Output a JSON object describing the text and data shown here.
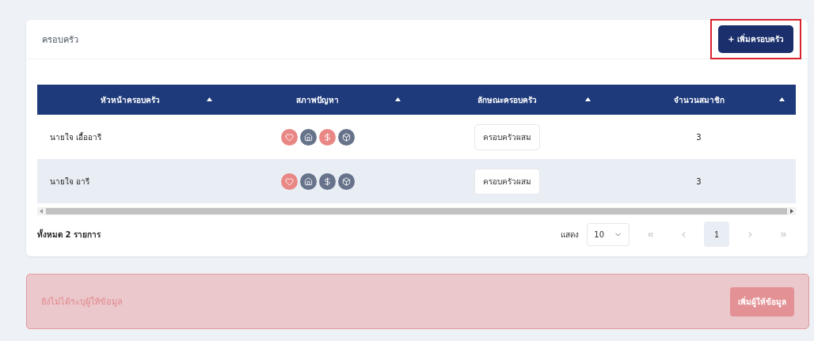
{
  "card": {
    "title": "ครอบครัว",
    "add_button": {
      "label": "+ เพิ่มครอบครัว",
      "highlighted": true
    }
  },
  "table": {
    "columns": [
      {
        "label": "หัวหน้าครอบครัว"
      },
      {
        "label": "สภาพปัญหา"
      },
      {
        "label": "ลักษณะครอบครัว"
      },
      {
        "label": "จำนวนสมาชิก"
      }
    ],
    "rows": [
      {
        "head": "นายใจ เอื้ออารี",
        "problems": [
          {
            "kind": "health",
            "active": true
          },
          {
            "kind": "housing",
            "active": false
          },
          {
            "kind": "income",
            "active": true
          },
          {
            "kind": "goods",
            "active": false
          }
        ],
        "family_type": "ครอบครัวผสม",
        "members": "3"
      },
      {
        "head": "นายใจ อารี",
        "problems": [
          {
            "kind": "health",
            "active": true
          },
          {
            "kind": "housing",
            "active": false
          },
          {
            "kind": "income",
            "active": false
          },
          {
            "kind": "goods",
            "active": false
          }
        ],
        "family_type": "ครอบครัวผสม",
        "members": "3"
      }
    ]
  },
  "footer": {
    "total": "ทั้งหมด 2 รายการ",
    "show_label": "แสดง",
    "page_size": "10",
    "pages": [
      {
        "label": "1",
        "selected": true
      }
    ]
  },
  "alert": {
    "message": "ยังไม่ได้ระบุผู้ให้ข้อมูล",
    "button": "เพิ่มผู้ให้ข้อมูล"
  }
}
